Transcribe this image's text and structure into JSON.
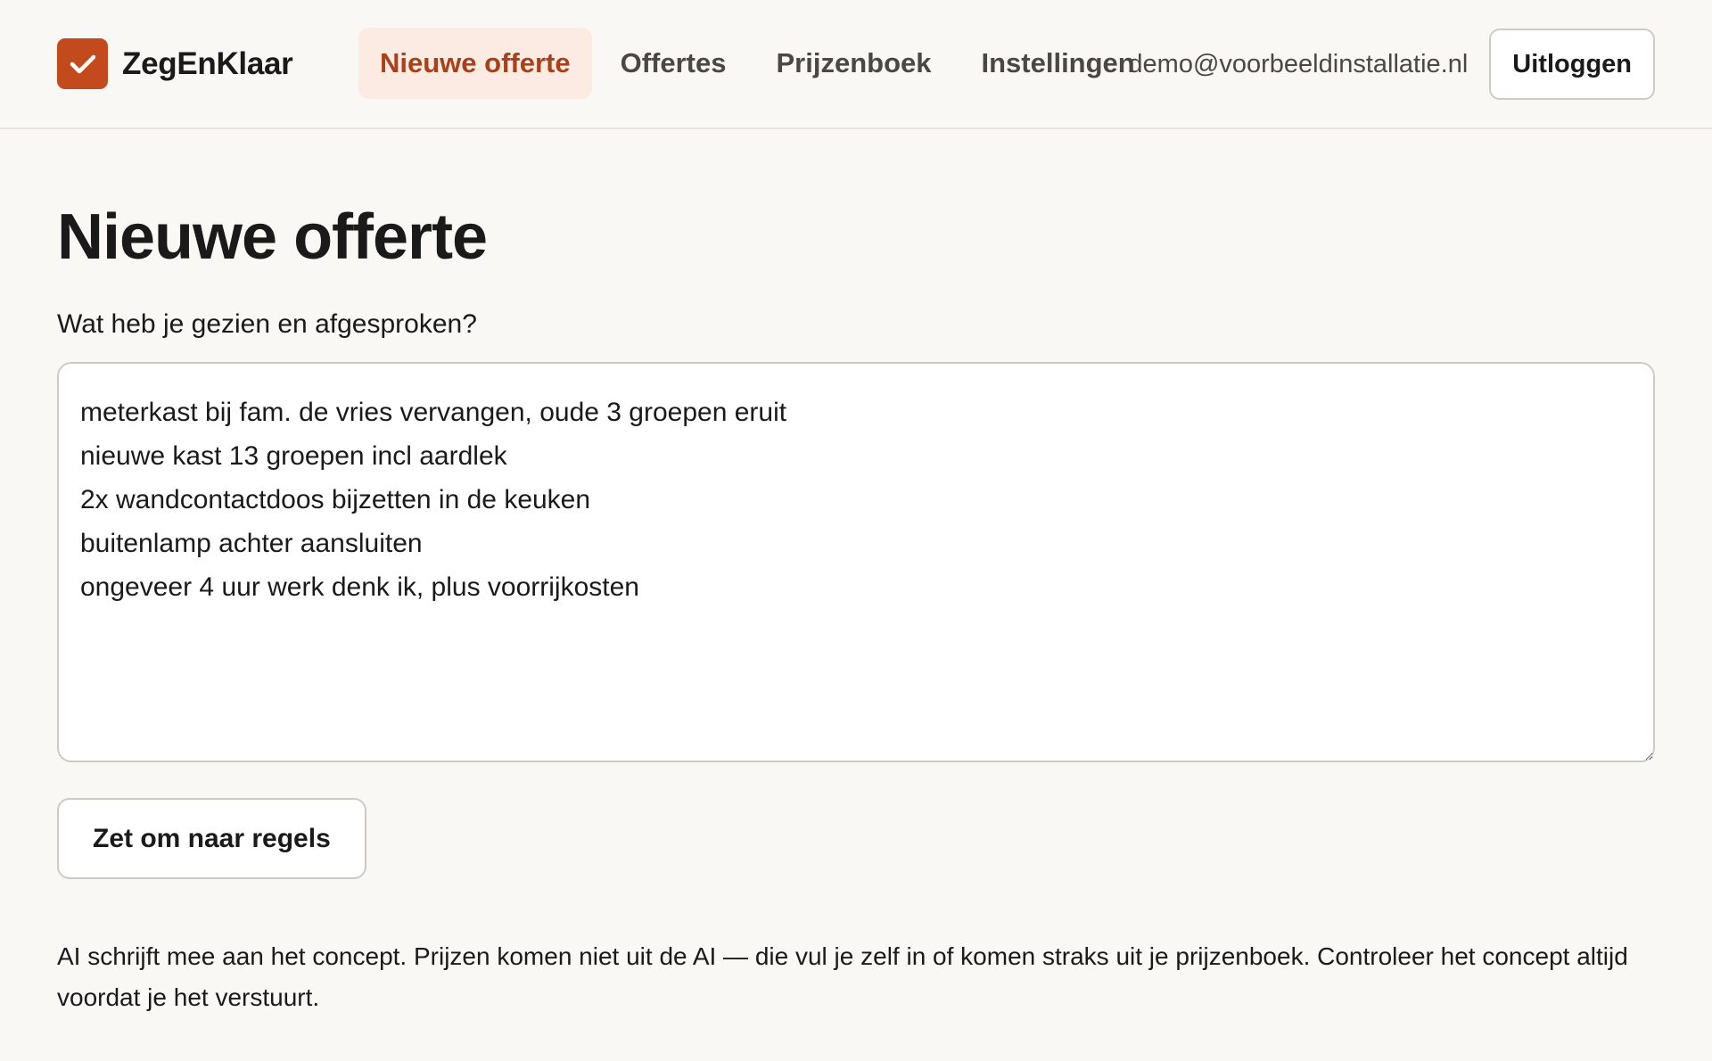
{
  "brand": {
    "name": "ZegEnKlaar",
    "logo_icon": "checkmark-icon",
    "accent_color": "#c24a1c"
  },
  "nav": {
    "items": [
      {
        "label": "Nieuwe offerte",
        "active": true
      },
      {
        "label": "Offertes",
        "active": false
      },
      {
        "label": "Prijzenboek",
        "active": false
      },
      {
        "label": "Instellingen",
        "active": false
      }
    ]
  },
  "account": {
    "email": "demo@voorbeeldinstallatie.nl",
    "logout_label": "Uitloggen"
  },
  "main": {
    "title": "Nieuwe offerte",
    "field_label": "Wat heb je gezien en afgesproken?",
    "notes_value": "meterkast bij fam. de vries vervangen, oude 3 groepen eruit\nnieuwe kast 13 groepen incl aardlek\n2x wandcontactdoos bijzetten in de keuken\nbuitenlamp achter aansluiten\nongeveer 4 uur werk denk ik, plus voorrijkosten",
    "convert_label": "Zet om naar regels",
    "disclaimer": "AI schrijft mee aan het concept. Prijzen komen niet uit de AI — die vul je zelf in of komen straks uit je prijzenboek. Controleer het concept altijd voordat je het verstuurt."
  }
}
